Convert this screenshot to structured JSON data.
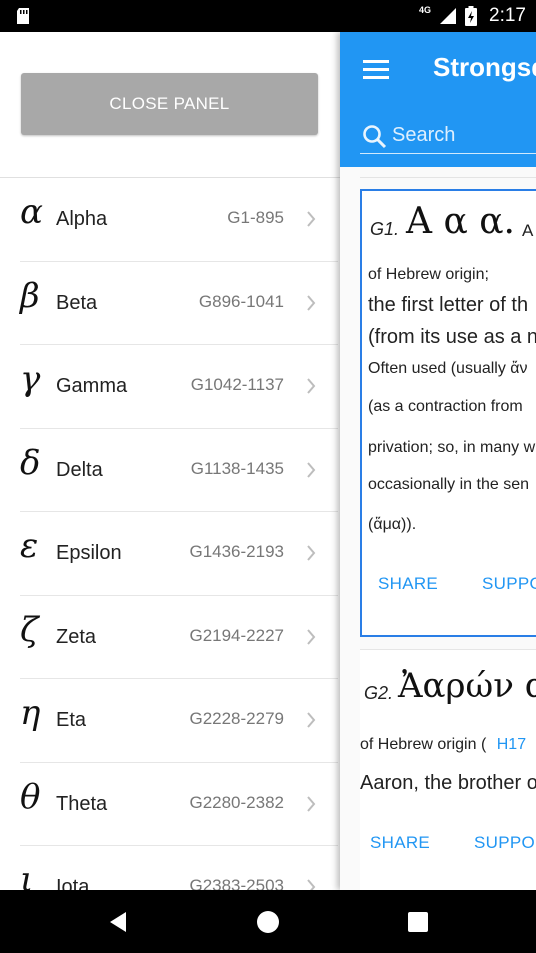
{
  "status_bar": {
    "network": "4G",
    "battery": "2",
    "time": "2:17"
  },
  "panel": {
    "close_label": "CLOSE PANEL",
    "letters": [
      {
        "glyph": "α",
        "name": "Alpha",
        "range": "G1-895"
      },
      {
        "glyph": "β",
        "name": "Beta",
        "range": "G896-1041"
      },
      {
        "glyph": "γ",
        "name": "Gamma",
        "range": "G1042-1137"
      },
      {
        "glyph": "δ",
        "name": "Delta",
        "range": "G1138-1435"
      },
      {
        "glyph": "ε",
        "name": "Epsilon",
        "range": "G1436-2193"
      },
      {
        "glyph": "ζ",
        "name": "Zeta",
        "range": "G2194-2227"
      },
      {
        "glyph": "η",
        "name": "Eta",
        "range": "G2228-2279"
      },
      {
        "glyph": "θ",
        "name": "Theta",
        "range": "G2280-2382"
      },
      {
        "glyph": "ι",
        "name": "Iota",
        "range": "G2383-2503"
      }
    ]
  },
  "appbar": {
    "title": "Strongsd",
    "search_placeholder": "Search"
  },
  "entries": [
    {
      "number": "G1.",
      "greek": "Α α α.",
      "trailing": "A",
      "origin": "of Hebrew origin;",
      "line1": "the first letter of th",
      "line2": "(from its use as a n",
      "details": [
        "Often used (usually ἄν",
        "(as a contraction from",
        "privation; so, in many w",
        "occasionally in the sen",
        "(ἅμα))."
      ],
      "share": "SHARE",
      "support": "SUPPO"
    },
    {
      "number": "G2.",
      "greek": "Ἀαρών α",
      "origin_prefix": "of Hebrew origin (",
      "origin_link": "H17",
      "line1": "Aaron, the brother o",
      "share": "SHARE",
      "support": "SUPPO"
    }
  ],
  "colors": {
    "primary": "#2196f3",
    "close_button": "#a8a8a8",
    "selected_border": "#2a7ee6"
  }
}
